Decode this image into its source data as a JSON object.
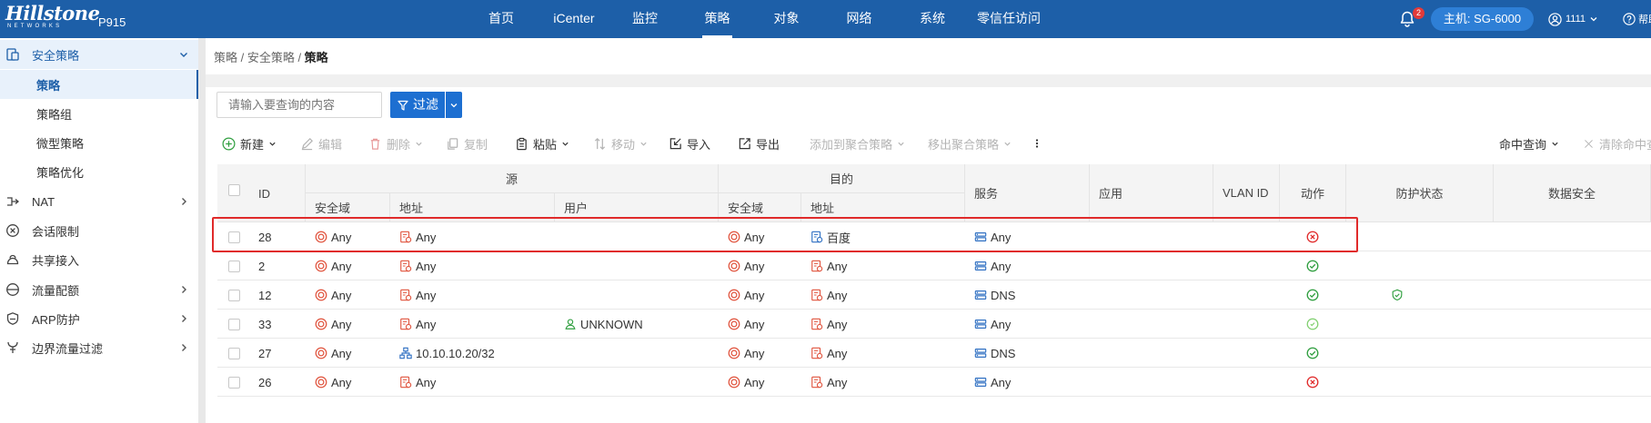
{
  "header": {
    "logo": "Hillstone",
    "logo_sub": "NETWORKS",
    "model": "P915",
    "nav": [
      "首页",
      "iCenter",
      "监控",
      "策略",
      "对象",
      "网络",
      "系统",
      "零信任访问"
    ],
    "nav_active_index": 3,
    "notification_count": "2",
    "host_label": "主机: SG-6000",
    "user": "1111",
    "help": "帮助"
  },
  "sidebar": {
    "group": "安全策略",
    "sub_items": [
      "策略",
      "策略组",
      "微型策略",
      "策略优化"
    ],
    "active_sub": "策略",
    "items": [
      {
        "label": "NAT",
        "icon": "nat-icon",
        "expandable": true
      },
      {
        "label": "会话限制",
        "icon": "session-limit-icon",
        "expandable": false
      },
      {
        "label": "共享接入",
        "icon": "share-access-icon",
        "expandable": false
      },
      {
        "label": "流量配额",
        "icon": "quota-icon",
        "expandable": true
      },
      {
        "label": "ARP防护",
        "icon": "arp-icon",
        "expandable": true
      },
      {
        "label": "边界流量过滤",
        "icon": "border-filter-icon",
        "expandable": true
      }
    ]
  },
  "breadcrumb": {
    "path": "策略 / 安全策略 / ",
    "current": "策略"
  },
  "search": {
    "placeholder": "请输入要查询的内容"
  },
  "filter": {
    "label": "过滤"
  },
  "toolbar": {
    "new": "新建",
    "edit": "编辑",
    "delete": "删除",
    "copy": "复制",
    "paste": "粘贴",
    "move": "移动",
    "import": "导入",
    "export": "导出",
    "add_aggregate": "添加到聚合策略",
    "remove_aggregate": "移出聚合策略",
    "hit_query": "命中查询",
    "clear_hit": "清除命中查询"
  },
  "table": {
    "headers": {
      "id": "ID",
      "source": "源",
      "destination": "目的",
      "src_zone": "安全域",
      "src_addr": "地址",
      "src_user": "用户",
      "dst_zone": "安全域",
      "dst_addr": "地址",
      "service": "服务",
      "app": "应用",
      "vlan": "VLAN ID",
      "action": "动作",
      "protection": "防护状态",
      "data_security": "数据安全"
    },
    "rows": [
      {
        "id": "28",
        "src_zone": "Any",
        "src_addr": "Any",
        "src_addr_type": "address-book",
        "user": "",
        "dst_zone": "Any",
        "dst_addr": "百度",
        "dst_addr_type": "address-book-blue",
        "service": "Any",
        "action": "deny",
        "protection": ""
      },
      {
        "id": "2",
        "src_zone": "Any",
        "src_addr": "Any",
        "src_addr_type": "address-book",
        "user": "",
        "dst_zone": "Any",
        "dst_addr": "Any",
        "dst_addr_type": "address-book",
        "service": "Any",
        "action": "permit",
        "protection": ""
      },
      {
        "id": "12",
        "src_zone": "Any",
        "src_addr": "Any",
        "src_addr_type": "address-book",
        "user": "",
        "dst_zone": "Any",
        "dst_addr": "Any",
        "dst_addr_type": "address-book",
        "service": "DNS",
        "action": "permit",
        "protection": "shield"
      },
      {
        "id": "33",
        "src_zone": "Any",
        "src_addr": "Any",
        "src_addr_type": "address-book",
        "user": "UNKNOWN",
        "dst_zone": "Any",
        "dst_addr": "Any",
        "dst_addr_type": "address-book",
        "service": "Any",
        "action": "permit-light",
        "protection": ""
      },
      {
        "id": "27",
        "src_zone": "Any",
        "src_addr": "10.10.10.20/32",
        "src_addr_type": "network",
        "user": "",
        "dst_zone": "Any",
        "dst_addr": "Any",
        "dst_addr_type": "address-book",
        "service": "DNS",
        "action": "permit",
        "protection": ""
      },
      {
        "id": "26",
        "src_zone": "Any",
        "src_addr": "Any",
        "src_addr_type": "address-book",
        "user": "",
        "dst_zone": "Any",
        "dst_addr": "Any",
        "dst_addr_type": "address-book",
        "service": "Any",
        "action": "deny",
        "protection": ""
      }
    ]
  },
  "colors": {
    "header_bg": "#1d5fa8",
    "accent": "#1d6fd1",
    "zone_icon": "#e0533d",
    "permit": "#2e9e3e",
    "deny": "#e02a2a",
    "highlight": "#e02a2a"
  }
}
